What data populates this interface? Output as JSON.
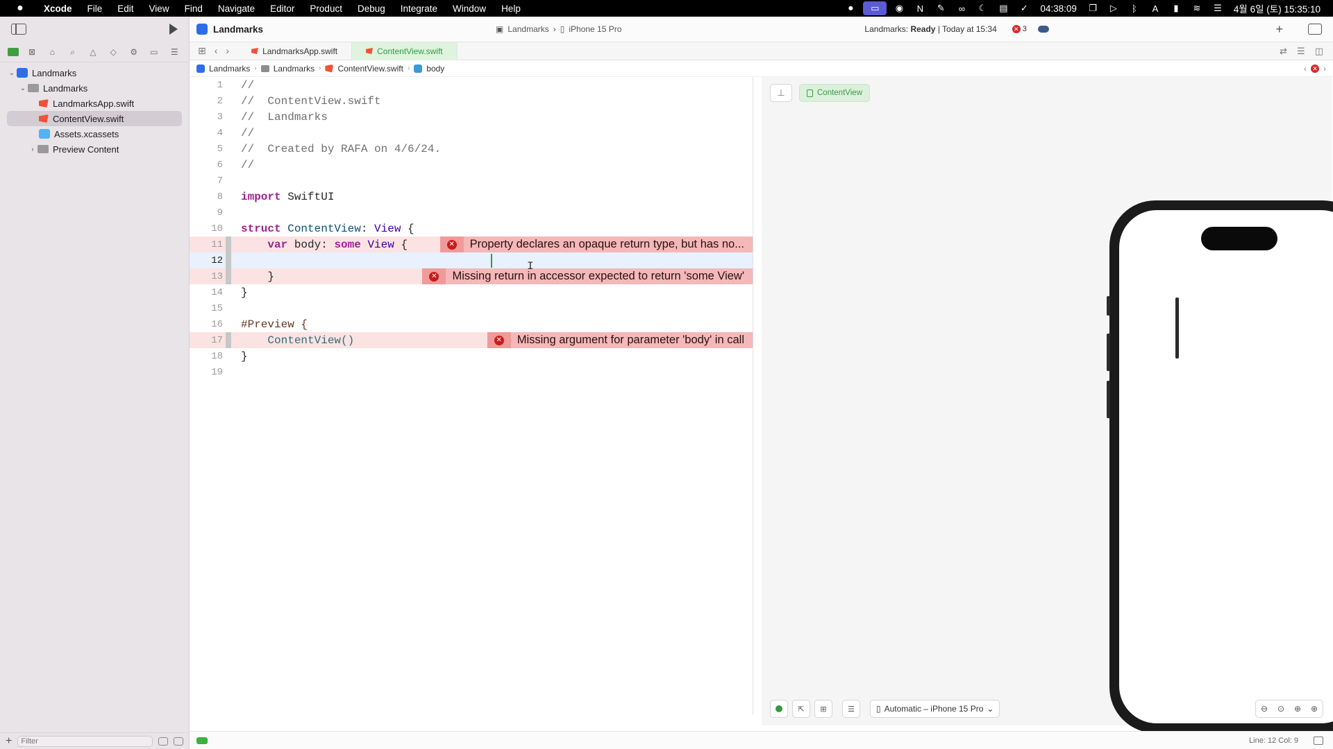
{
  "menubar": {
    "app": "Xcode",
    "items": [
      "File",
      "Edit",
      "View",
      "Find",
      "Navigate",
      "Editor",
      "Product",
      "Debug",
      "Integrate",
      "Window",
      "Help"
    ],
    "time_timer": "04:38:09",
    "datetime": "4월 6일 (토) 15:35:10",
    "input_mode": "A"
  },
  "sidebar": {
    "tree": [
      {
        "label": "Landmarks",
        "level": 0,
        "icon": "project-icon",
        "expanded": true
      },
      {
        "label": "Landmarks",
        "level": 1,
        "icon": "folder-icon",
        "expanded": true
      },
      {
        "label": "LandmarksApp.swift",
        "level": 2,
        "icon": "swift-file-icon"
      },
      {
        "label": "ContentView.swift",
        "level": 2,
        "icon": "swift-file-icon",
        "selected": true
      },
      {
        "label": "Assets.xcassets",
        "level": 2,
        "icon": "assets-icon"
      },
      {
        "label": "Preview Content",
        "level": 2,
        "icon": "folder-icon",
        "expanded": false
      }
    ],
    "filter_placeholder": "Filter"
  },
  "toolbar": {
    "project_title": "Landmarks",
    "scheme": "Landmarks",
    "destination": "iPhone 15 Pro",
    "status_prefix": "Landmarks: ",
    "status_state": "Ready",
    "status_suffix": " | Today at 15:34",
    "error_count": "3"
  },
  "tabs": [
    {
      "label": "LandmarksApp.swift",
      "active": false
    },
    {
      "label": "ContentView.swift",
      "active": true
    }
  ],
  "jumpbar": [
    "Landmarks",
    "Landmarks",
    "ContentView.swift",
    "body"
  ],
  "code": {
    "lines": [
      {
        "n": "1",
        "text": "//"
      },
      {
        "n": "2",
        "text": "//  ContentView.swift"
      },
      {
        "n": "3",
        "text": "//  Landmarks"
      },
      {
        "n": "4",
        "text": "//"
      },
      {
        "n": "5",
        "text": "//  Created by RAFA on 4/6/24."
      },
      {
        "n": "6",
        "text": "//"
      },
      {
        "n": "7",
        "text": ""
      },
      {
        "n": "8",
        "text": "import SwiftUI"
      },
      {
        "n": "9",
        "text": ""
      },
      {
        "n": "10",
        "text": "struct ContentView: View {"
      },
      {
        "n": "11",
        "text": "    var body: some View {"
      },
      {
        "n": "12",
        "text": ""
      },
      {
        "n": "13",
        "text": "    }"
      },
      {
        "n": "14",
        "text": "}"
      },
      {
        "n": "15",
        "text": ""
      },
      {
        "n": "16",
        "text": "#Preview {"
      },
      {
        "n": "17",
        "text": "    ContentView()"
      },
      {
        "n": "18",
        "text": "}"
      },
      {
        "n": "19",
        "text": ""
      }
    ],
    "current_line": "12"
  },
  "errors": [
    {
      "line": "11",
      "message": "Property declares an opaque return type, but has no..."
    },
    {
      "line": "13",
      "message": "Missing return in accessor expected to return 'some View'"
    },
    {
      "line": "17",
      "message": "Missing argument for parameter 'body' in call"
    }
  ],
  "canvas": {
    "preview_label": "ContentView",
    "device_selector": "Automatic – iPhone 15 Pro"
  },
  "statusbar": {
    "line_col": "Line: 12  Col: 9"
  },
  "colors": {
    "error_red": "#d62b2b",
    "error_bg": "#f4b8b8",
    "active_tab": "#2f9c3f"
  }
}
